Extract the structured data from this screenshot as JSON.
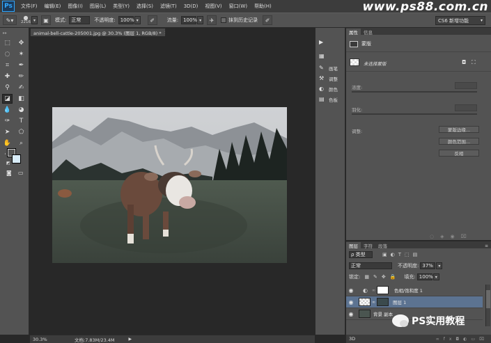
{
  "app": {
    "logo": "Ps"
  },
  "watermark": "www.ps88.com.cn",
  "menu": [
    "文件(F)",
    "编辑(E)",
    "图像(I)",
    "图层(L)",
    "类型(Y)",
    "选择(S)",
    "滤镜(T)",
    "3D(D)",
    "视图(V)",
    "窗口(W)",
    "帮助(H)"
  ],
  "options": {
    "brush_size": "2216",
    "mode_label": "模式:",
    "mode_value": "正常",
    "opacity_label": "不透明度:",
    "opacity_value": "100%",
    "flow_label": "流量:",
    "flow_value": "100%",
    "history_label": "抹到历史记录",
    "workspace": "CS6 新增功能"
  },
  "document": {
    "tab_title": "animal-bell-cattle-205001.jpg @ 30.3% (图层 1, RGB/8) *",
    "close": "×",
    "zoom": "30.3%",
    "doc_info": "文档:7.83M/23.4M"
  },
  "icon_strip": [
    {
      "icon": "play-icon",
      "glyph": "▶",
      "label": ""
    },
    {
      "icon": "grid-icon",
      "glyph": "▦",
      "label": ""
    },
    {
      "icon": "brush-icon",
      "glyph": "✎",
      "label": "画笔"
    },
    {
      "icon": "tools-icon",
      "glyph": "⚒",
      "label": "调整"
    },
    {
      "icon": "color-icon",
      "glyph": "◐",
      "label": "颜色"
    },
    {
      "icon": "swatches-icon",
      "glyph": "▤",
      "label": "色板"
    }
  ],
  "properties": {
    "tabs": [
      "属性",
      "信息"
    ],
    "section_title": "蒙版",
    "mask_status": "未选择蒙版",
    "density_label": "浓度:",
    "feather_label": "羽化:",
    "adjust_label": "调整:",
    "buttons": [
      "蒙版边缘...",
      "颜色范围...",
      "反相"
    ]
  },
  "layers": {
    "tabs": [
      "图层",
      "字符",
      "段落"
    ],
    "filter_value": "ρ 类型",
    "blend_mode": "正常",
    "opacity_label": "不透明度:",
    "opacity_value": "37%",
    "lock_label": "锁定:",
    "fill_label": "填充:",
    "fill_value": "100%",
    "items": [
      {
        "name": "色相/饱和度 1",
        "selected": false
      },
      {
        "name": "图层 1",
        "selected": true
      },
      {
        "name": "背景 副本",
        "selected": false
      }
    ]
  },
  "bottom_right": "3D",
  "wechat_text": "PS实用教程"
}
